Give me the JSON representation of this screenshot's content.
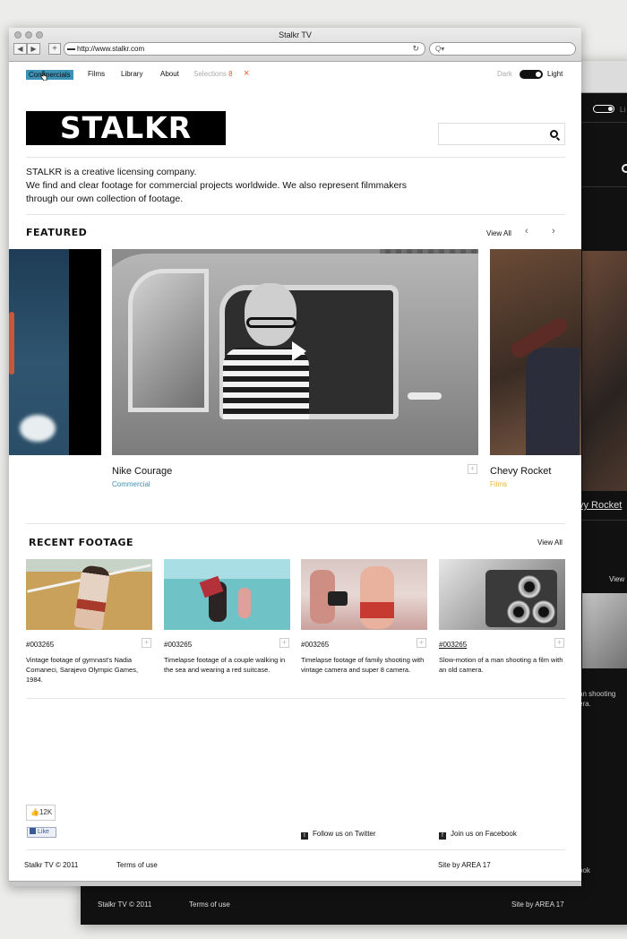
{
  "browser": {
    "window_title": "Stalkr TV",
    "url": "http://www.stalkr.com",
    "nav_back": "◀",
    "nav_forward": "▶",
    "new_tab": "+",
    "reload": "↻",
    "search_placeholder": "Q▾"
  },
  "nav": {
    "items": [
      "Commercials",
      "Films",
      "Library",
      "About"
    ],
    "active": "Commercials",
    "selections_label": "Selections",
    "selections_count": "8",
    "clear_icon": "×",
    "theme_dark": "Dark",
    "theme_light": "Light"
  },
  "brand": {
    "logo_text": "STALKR"
  },
  "intro": {
    "line1": "STALKR is a creative licensing company.",
    "line2": "We find and clear footage for commercial projects worldwide. We also represent filmmakers through our own collection of footage."
  },
  "featured": {
    "heading": "FEATURED",
    "view_all": "View All",
    "prev_icon": "‹",
    "next_icon": "›",
    "items": [
      {
        "title": "Nike Courage",
        "category": "Commercial",
        "category_color": "#3d92b7"
      },
      {
        "title": "Chevy Rocket",
        "category": "Films",
        "category_color": "#e8b83a"
      }
    ],
    "add_icon": "+"
  },
  "recent": {
    "heading": "RECENT FOOTAGE",
    "view_all": "View All",
    "items": [
      {
        "id": "#003265",
        "desc": "Vintage footage of gymnast's Nadia Comaneci, Sarajevo Olympic Games, 1984."
      },
      {
        "id": "#003265",
        "desc": "Timelapse footage of a couple walking in the sea and wearing a red suitcase."
      },
      {
        "id": "#003265",
        "desc": "Timelapse footage of family shooting  with vintage camera and super 8 camera."
      },
      {
        "id": "#003265",
        "desc": "Slow-motion of a man shooting a film with an old camera."
      }
    ]
  },
  "social": {
    "like_count": "12K",
    "like_label": "Like",
    "twitter": "Follow us on Twitter",
    "facebook": "Join us on Facebook"
  },
  "footer": {
    "copyright": "Stalkr TV © 2011",
    "terms": "Terms of use",
    "credit": "Site by AREA 17"
  },
  "back_window": {
    "light_fragment": "Li",
    "k_fragment": "k",
    "arrow_fragment": "ll",
    "title_fragment": "vy Rocket",
    "view_fragment": "View",
    "desc_fragment1": "an shooting",
    "desc_fragment2": "era.",
    "book_fragment": "ook",
    "copyright": "Stalkr TV © 2011",
    "terms": "Terms of use",
    "credit": "Site by AREA 17"
  },
  "colors": {
    "accent": "#3d92b7",
    "selection": "#e55a2a",
    "films": "#e8b83a"
  }
}
